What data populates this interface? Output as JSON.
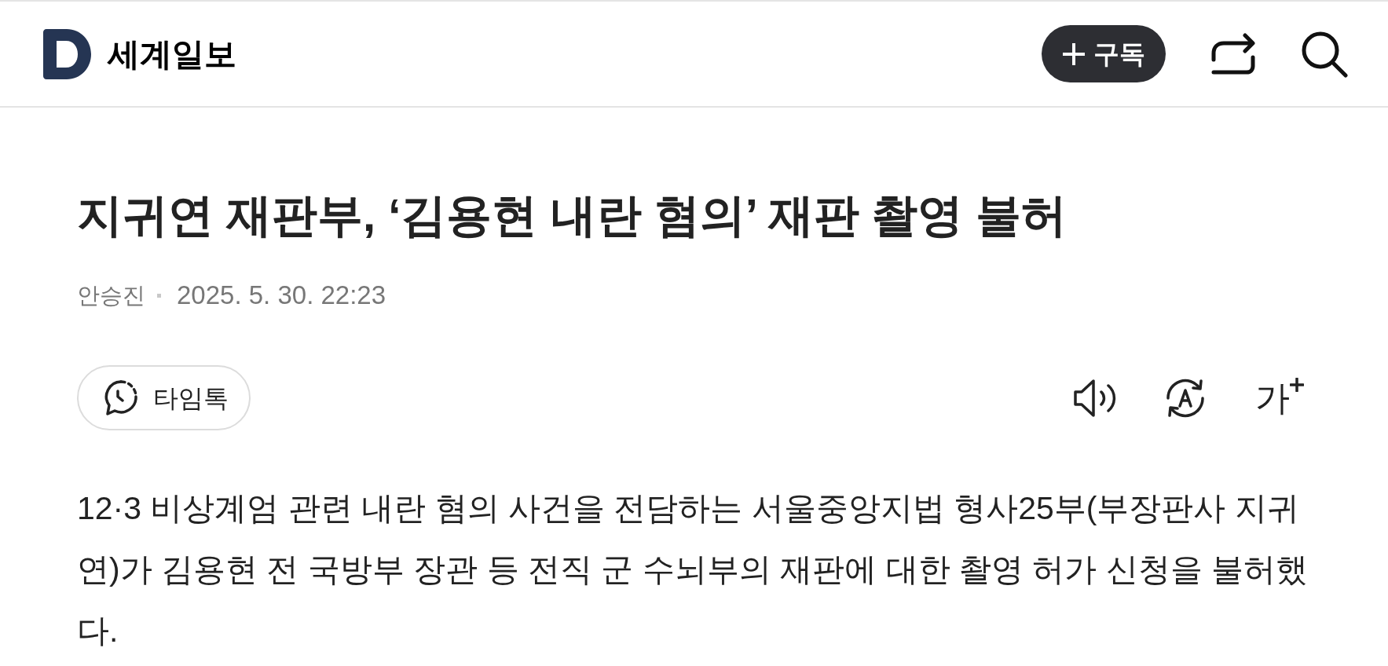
{
  "header": {
    "logo_text": "세계일보",
    "subscribe_button": {
      "label": "구독"
    }
  },
  "article": {
    "title": "지귀연 재판부, ‘김용현 내란 혐의’ 재판 촬영 불허",
    "author": "안승진",
    "date": "2025. 5. 30. 22:23",
    "timetalk_button": {
      "label": "타임톡"
    },
    "font_size_button": {
      "label": "가"
    },
    "body": "12·3 비상계엄 관련 내란 혐의 사건을 전담하는 서울중앙지법 형사25부(부장판사 지귀연)가 김용현 전 국방부 장관 등 전직 군 수뇌부의 재판에 대한 촬영 허가 신청을 불허했다."
  }
}
